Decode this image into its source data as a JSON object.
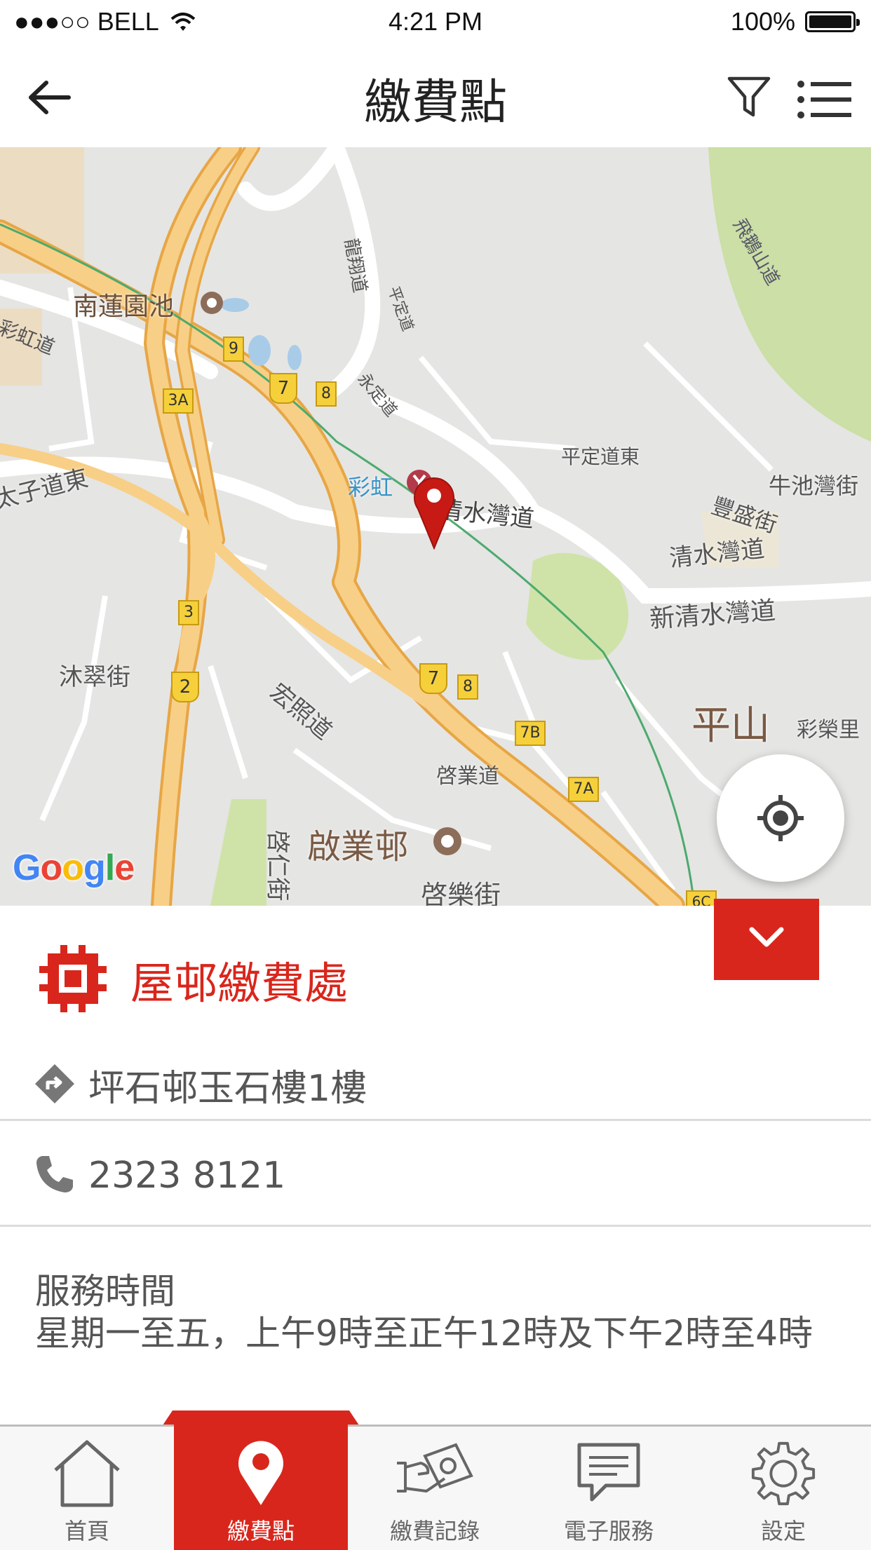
{
  "status_bar": {
    "carrier": "●●●○○ BELL",
    "time": "4:21 PM",
    "battery": "100%"
  },
  "nav": {
    "title": "繳費點"
  },
  "map": {
    "labels": {
      "nam_lin": "南蓮園池",
      "choi_hung": "彩虹",
      "tai_tsz_east": "太子道東",
      "clear_water_bay": "清水灣道",
      "ping_ting_east": "平定道東",
      "ngau_chi_wan": "牛池灣街",
      "fung_shing": "豐盛街",
      "clear_water_bay_2": "清水灣道",
      "new_clear_water_bay": "新清水灣道",
      "muk_chui": "沐翠街",
      "wang_chiu": "宏照道",
      "kai_yip_road": "啓業道",
      "kai_yip_estate": "啟業邨",
      "kai_lok": "啓樂街",
      "kai_yan": "啓仁街",
      "ping_shan": "平山",
      "choi_wing": "彩榮里",
      "fei_ngo_shan": "飛鵝山道",
      "ping_ting_rd": "平定道",
      "wing_ting_rd": "永定道",
      "ma_shan": "龍翔道",
      "choi_hung_rd": "彩虹道"
    },
    "route_shields": [
      "9",
      "7",
      "8",
      "3A",
      "3",
      "2",
      "7",
      "8",
      "7B",
      "7A",
      "6C"
    ],
    "google": "Google"
  },
  "office": {
    "name": "屋邨繳費處",
    "address": "坪石邨玉石樓1樓",
    "phone": "2323 8121",
    "hours_title": "服務時間",
    "hours": "星期一至五，上午9時至正午12時及下午2時至4時"
  },
  "tabs": [
    {
      "label": "首頁",
      "icon": "home-icon",
      "active": false
    },
    {
      "label": "繳費點",
      "icon": "location-pin-icon",
      "active": true
    },
    {
      "label": "繳費記錄",
      "icon": "payment-record-icon",
      "active": false
    },
    {
      "label": "電子服務",
      "icon": "message-icon",
      "active": false
    },
    {
      "label": "設定",
      "icon": "gear-icon",
      "active": false
    }
  ],
  "colors": {
    "accent": "#d9261c",
    "map_road_major": "#f6c97a",
    "map_road_edge": "#e7a645",
    "map_green": "#c8dfa4"
  }
}
